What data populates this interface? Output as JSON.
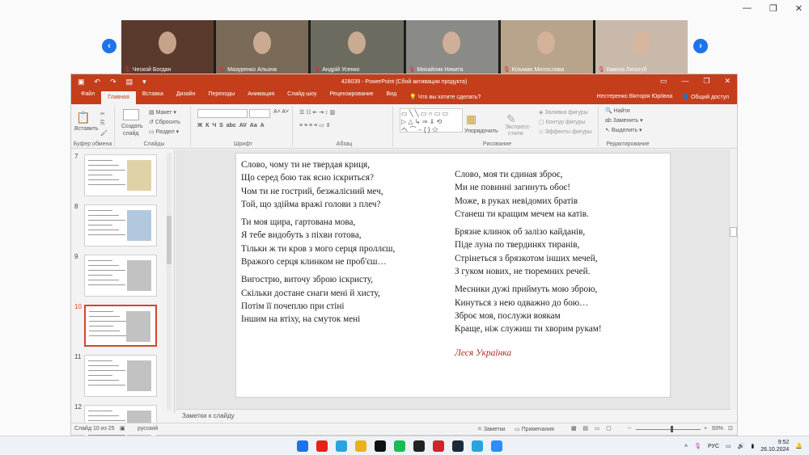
{
  "zoom": {
    "participants": [
      {
        "name": "Ческой Богдан",
        "bg": "#5a3a2c"
      },
      {
        "name": "Мазуренко Альона",
        "bg": "#7a6a58"
      },
      {
        "name": "Андрій Усенко",
        "bg": "#6b6b60"
      },
      {
        "name": "Михайлик Никита",
        "bg": "#8a8a86"
      },
      {
        "name": "Кільман Милослава",
        "bg": "#b7a48a"
      },
      {
        "name": "Каміла Лизогуб",
        "bg": "#c9b9aa"
      }
    ],
    "prev": "‹",
    "next": "›"
  },
  "window_controls": {
    "minimize": "—",
    "restore": "❐",
    "close": "✕"
  },
  "ppt": {
    "title": "428039 - PowerPoint (Сбой активации продукта)",
    "tabs": [
      "Файл",
      "Главная",
      "Вставка",
      "Дизайн",
      "Переходы",
      "Анимация",
      "Слайд-шоу",
      "Рецензирование",
      "Вид"
    ],
    "active_tab": "Главная",
    "tell_me": "Что вы хотите сделать?",
    "user": "Нестеренко Вікторія Юріївна",
    "share": "Общий доступ",
    "ribbon": {
      "clipboard": {
        "paste": "Вставить",
        "label": "Буфер обмена"
      },
      "slides": {
        "create": "Создать",
        "create2": "слайд",
        "layout": "Макет",
        "reset": "Сбросить",
        "section": "Раздел",
        "label": "Слайды"
      },
      "font_label": "Шрифт",
      "paragraph_label": "Абзац",
      "drawing": {
        "arrange": "Упорядочить",
        "styles": "Экспресс-",
        "styles2": "стили",
        "fill": "Заливка фигуры",
        "outline": "Контур фигуры",
        "effects": "Эффекты фигуры",
        "label": "Рисование"
      },
      "editing": {
        "find": "Найти",
        "replace": "Заменить",
        "select": "Выделить",
        "label": "Редактирование"
      }
    },
    "thumb_numbers": [
      "7",
      "8",
      "9",
      "10",
      "11",
      "12"
    ],
    "selected_thumb": "10",
    "slide": {
      "left_stanzas": [
        [
          "Слово, чому ти не твердая криця,",
          "Що серед бою так ясно іскриться?",
          "Чом ти не гострий, безжалісний меч,",
          "Той, що здійма вражі голови з плеч?"
        ],
        [
          "Ти моя щира, гартована мова,",
          "Я тебе видобуть з піхви готова,",
          "Тільки ж ти кров з мого серця проллєш,",
          "Вражого серця клинком не проб'єш…"
        ],
        [
          "Вигострю, виточу зброю іскристу,",
          "Скільки достане снаги мені й хисту,",
          "Потім її почеплю при стіні",
          "Іншим на втіху, на смуток мені"
        ]
      ],
      "right_stanzas": [
        [
          "Слово, моя ти єдиная зброє,",
          "Ми не повинні загинуть обоє!",
          "Може, в руках невідомих братів",
          "Станеш ти кращим мечем на катів."
        ],
        [
          "Брязне клинок об залізо кайданів,",
          "Піде луна по твердинях тиранів,",
          "Стрінеться з брязкотом інших мечей,",
          "З гуком нових, не тюремних речей."
        ],
        [
          "Месники дужі приймуть мою зброю,",
          "Кинуться з нею одважно до бою…",
          "Зброє моя, послужи воякам",
          "Краще, ніж служиш ти хворим рукам!"
        ]
      ],
      "signature": "Леся Українка"
    },
    "notes": "Заметки к слайду",
    "status": {
      "slide": "Слайд 10 из 25",
      "lang": "русский",
      "notes": "Заметки",
      "comments": "Примечания",
      "zoom": "93%"
    }
  },
  "taskbar": {
    "time": "9:52",
    "date": "26.10.2024",
    "lang": "РУС",
    "icons": [
      {
        "name": "windows",
        "color": "#1a73e8"
      },
      {
        "name": "youtube",
        "color": "#e62117"
      },
      {
        "name": "telegram",
        "color": "#2aa3df"
      },
      {
        "name": "chrome",
        "color": "#e6b31e"
      },
      {
        "name": "tiktok",
        "color": "#111111"
      },
      {
        "name": "spotify",
        "color": "#1db954"
      },
      {
        "name": "app-oval",
        "color": "#222222"
      },
      {
        "name": "pinterest",
        "color": "#d0232b"
      },
      {
        "name": "steam",
        "color": "#1b2a3a"
      },
      {
        "name": "telegram2",
        "color": "#2aa3df"
      },
      {
        "name": "zoom",
        "color": "#2d8cff"
      }
    ]
  }
}
